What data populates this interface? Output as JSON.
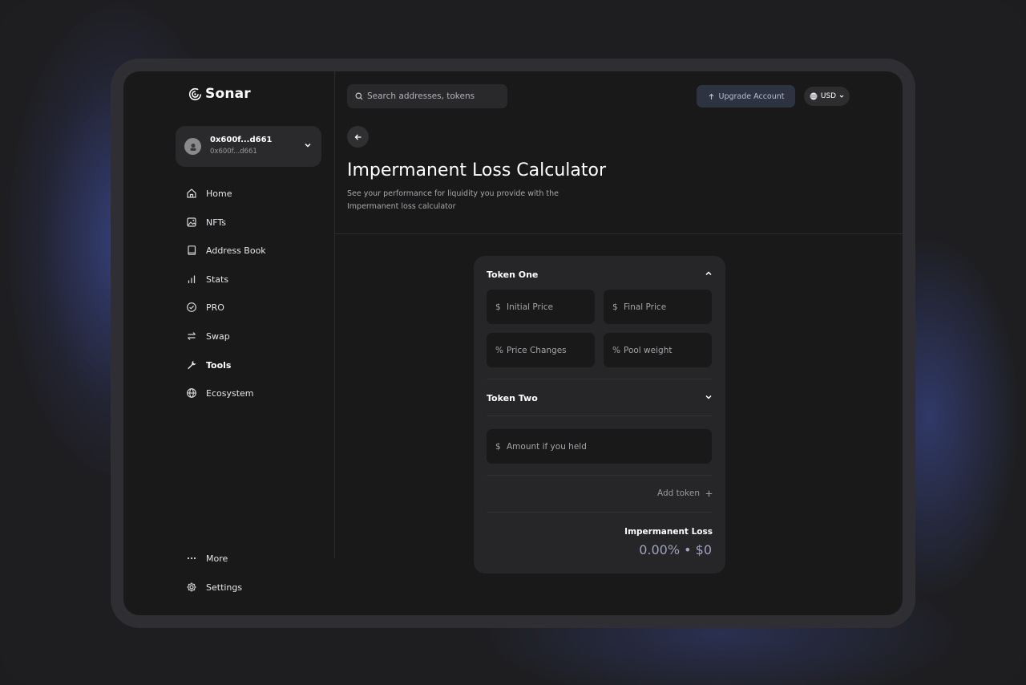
{
  "app": {
    "logo_text": "Sonar"
  },
  "account": {
    "name": "0x600f...d661",
    "address": "0x600f...d661"
  },
  "sidebar": {
    "items": [
      {
        "label": "Home",
        "icon": "home-icon"
      },
      {
        "label": "NFTs",
        "icon": "image-icon"
      },
      {
        "label": "Address Book",
        "icon": "book-icon"
      },
      {
        "label": "Stats",
        "icon": "stats-icon"
      },
      {
        "label": "PRO",
        "icon": "check-circle-icon"
      },
      {
        "label": "Swap",
        "icon": "swap-icon"
      },
      {
        "label": "Tools",
        "icon": "wrench-icon",
        "active": true
      },
      {
        "label": "Ecosystem",
        "icon": "globe-icon"
      }
    ],
    "bottom": [
      {
        "label": "More",
        "icon": "more-icon"
      },
      {
        "label": "Settings",
        "icon": "gear-icon"
      }
    ]
  },
  "header": {
    "search_placeholder": "Search addresses, tokens",
    "upgrade_label": "Upgrade Account",
    "currency": "USD"
  },
  "page": {
    "title": "Impermanent Loss Calculator",
    "description": "See your performance for liquidity you provide with the Impermanent loss calculator"
  },
  "calculator": {
    "token_one": {
      "title": "Token One",
      "fields": [
        {
          "prefix": "$",
          "placeholder": "Initial Price"
        },
        {
          "prefix": "$",
          "placeholder": "Final Price"
        },
        {
          "prefix": "%",
          "placeholder": "Price Changes"
        },
        {
          "prefix": "%",
          "placeholder": "Pool weight"
        }
      ]
    },
    "token_two": {
      "title": "Token Two"
    },
    "held_field": {
      "prefix": "$",
      "placeholder": "Amount if you held"
    },
    "add_token_label": "Add token",
    "result_label": "Impermanent Loss",
    "result_value": "0.00% • $0"
  },
  "colors": {
    "accent": "#9ea2bc",
    "background": "#19191a",
    "card": "#262628"
  }
}
